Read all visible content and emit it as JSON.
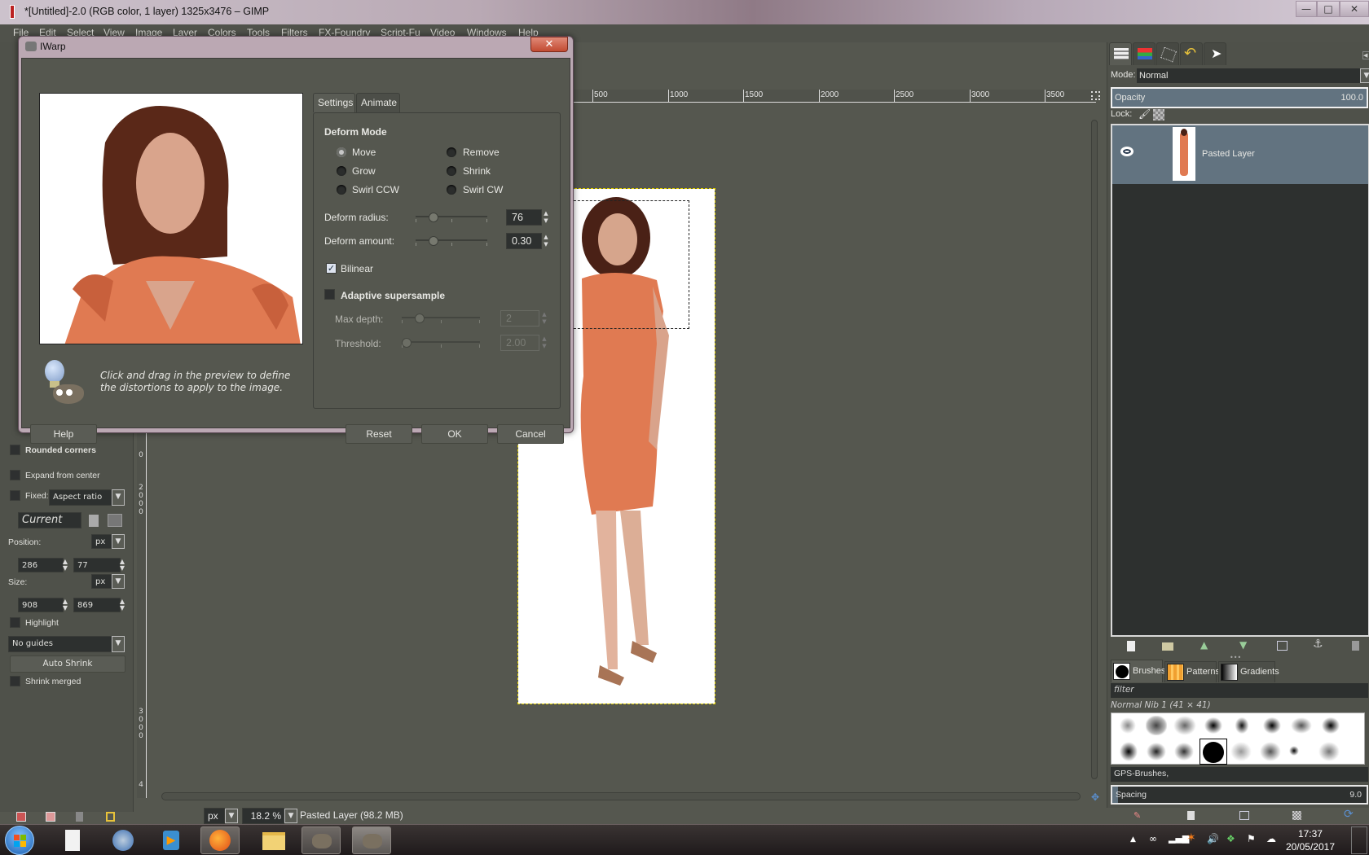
{
  "window": {
    "title": "*[Untitled]-2.0 (RGB color, 1 layer) 1325x3476 – GIMP",
    "controls": {
      "minimize": "—",
      "maximize": "□",
      "close": "✕"
    }
  },
  "menubar": [
    "File",
    "Edit",
    "Select",
    "View",
    "Image",
    "Layer",
    "Colors",
    "Tools",
    "Filters",
    "FX-Foundry",
    "Script-Fu",
    "Video",
    "Windows",
    "Help"
  ],
  "toolbox": {
    "rounded_corners": {
      "label": "Rounded corners",
      "checked": false
    },
    "expand_from_center": {
      "label": "Expand from center",
      "checked": false
    },
    "fixed": {
      "label": "Fixed:",
      "checked": false,
      "value": "Aspect ratio"
    },
    "current": "Current",
    "position": {
      "label": "Position:",
      "unit": "px",
      "x": "286",
      "y": "77"
    },
    "size": {
      "label": "Size:",
      "unit": "px",
      "w": "908",
      "h": "869"
    },
    "highlight": {
      "label": "Highlight",
      "checked": false
    },
    "guides": "No guides",
    "auto_shrink": "Auto Shrink",
    "shrink_merged": {
      "label": "Shrink merged",
      "checked": false
    }
  },
  "rulers": {
    "horizontal": [
      "500",
      "1000",
      "1500",
      "2000",
      "2500",
      "3000",
      "3500"
    ],
    "vertical": [
      "0",
      "2",
      "0",
      "0",
      "0",
      "3",
      "0",
      "0",
      "0",
      "4"
    ]
  },
  "statusbar": {
    "unit": "px",
    "zoom": "18.2 %",
    "info": "Pasted Layer (98.2 MB)"
  },
  "dock": {
    "tabs": [
      "layers-icon",
      "channels-icon",
      "paths-icon",
      "undo-history-icon",
      "pointer-icon"
    ],
    "mode_label": "Mode:",
    "mode_value": "Normal",
    "opacity_label": "Opacity",
    "opacity_value": "100.0",
    "lock_label": "Lock:",
    "layers": [
      {
        "name": "Pasted Layer",
        "visible": true
      }
    ],
    "resource_tabs": [
      "Brushes",
      "Patterns",
      "Gradients"
    ],
    "filter_placeholder": "filter",
    "brush_name": "Normal Nib 1 (41 × 41)",
    "brush_tag": "GPS-Brushes,",
    "spacing_label": "Spacing",
    "spacing_value": "9.0"
  },
  "dialog": {
    "title": "IWarp",
    "close": "✕",
    "tabs": [
      "Settings",
      "Animate"
    ],
    "deform_mode_heading": "Deform Mode",
    "modes": [
      {
        "label": "Move",
        "selected": true
      },
      {
        "label": "Remove",
        "selected": false
      },
      {
        "label": "Grow",
        "selected": false
      },
      {
        "label": "Shrink",
        "selected": false
      },
      {
        "label": "Swirl CCW",
        "selected": false
      },
      {
        "label": "Swirl CW",
        "selected": false
      }
    ],
    "deform_radius": {
      "label": "Deform radius:",
      "value": "76"
    },
    "deform_amount": {
      "label": "Deform amount:",
      "value": "0.30"
    },
    "bilinear": {
      "label": "Bilinear",
      "checked": true
    },
    "adaptive_supersample": {
      "label": "Adaptive supersample",
      "checked": false
    },
    "max_depth": {
      "label": "Max depth:",
      "value": "2"
    },
    "threshold": {
      "label": "Threshold:",
      "value": "2.00"
    },
    "hint": "Click and drag in the preview to define the distortions to apply to the image.",
    "buttons": {
      "help": "Help",
      "reset": "Reset",
      "ok": "OK",
      "cancel": "Cancel"
    }
  },
  "taskbar": {
    "apps": [
      "start-button",
      "libreoffice",
      "thunderbird",
      "media-player",
      "firefox",
      "file-explorer",
      "gimp",
      "gimp"
    ],
    "time": "17:37",
    "date": "20/05/2017"
  }
}
